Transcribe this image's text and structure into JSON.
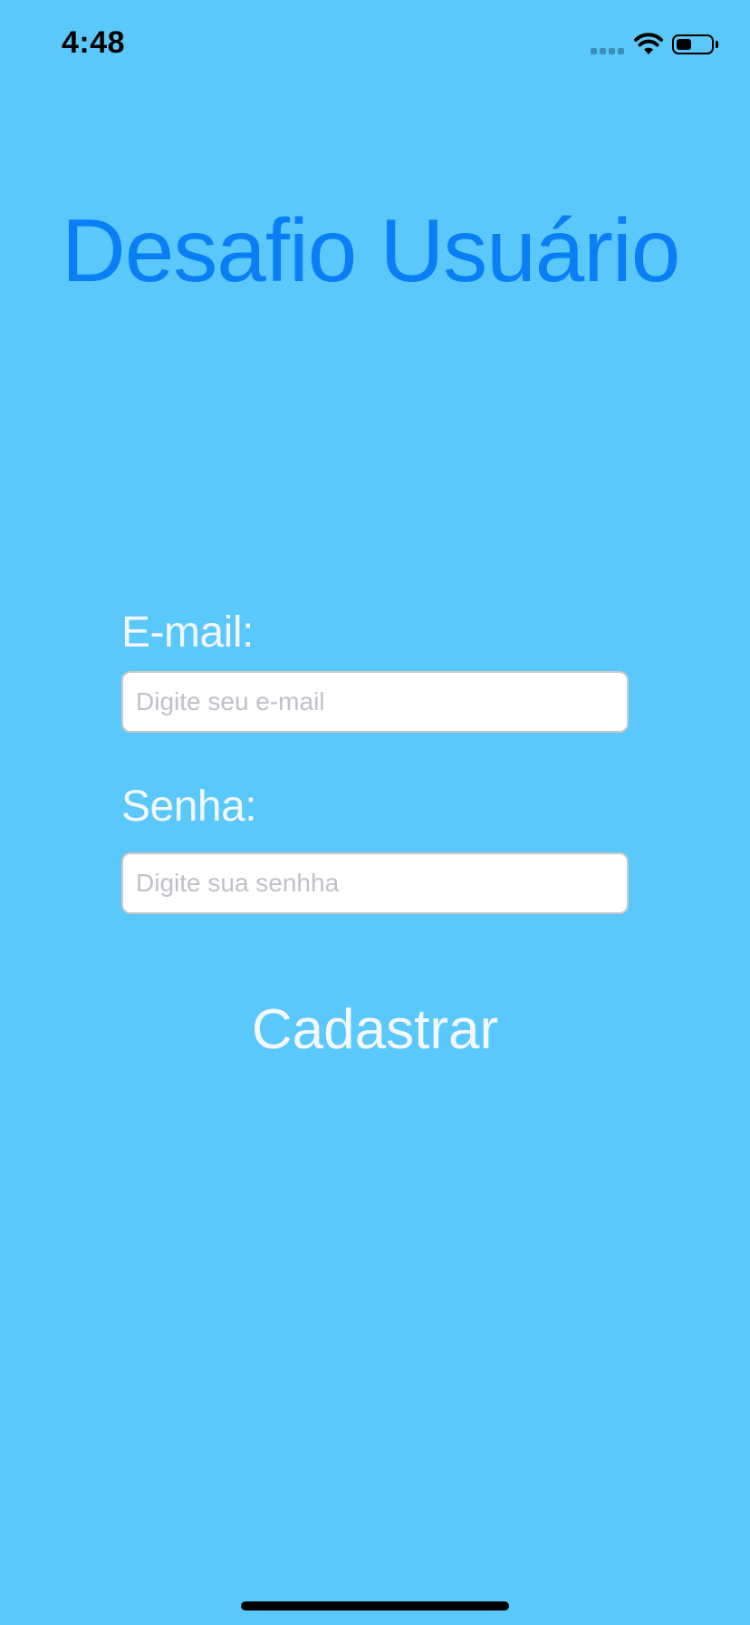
{
  "status_bar": {
    "time": "4:48",
    "battery_level": 0.45
  },
  "app": {
    "title": "Desafio Usuário"
  },
  "form": {
    "email_label": "E-mail:",
    "email_value": "",
    "email_placeholder": "Digite seu e-mail",
    "password_label": "Senha:",
    "password_value": "",
    "password_placeholder": "Digite sua senhha",
    "submit_label": "Cadastrar"
  },
  "colors": {
    "background": "#5ac8fa",
    "title": "#0a7ff5",
    "label": "#f2f8fc"
  },
  "icons": {
    "signal": "cellular-signal-icon",
    "wifi": "wifi-icon",
    "battery": "battery-icon"
  }
}
